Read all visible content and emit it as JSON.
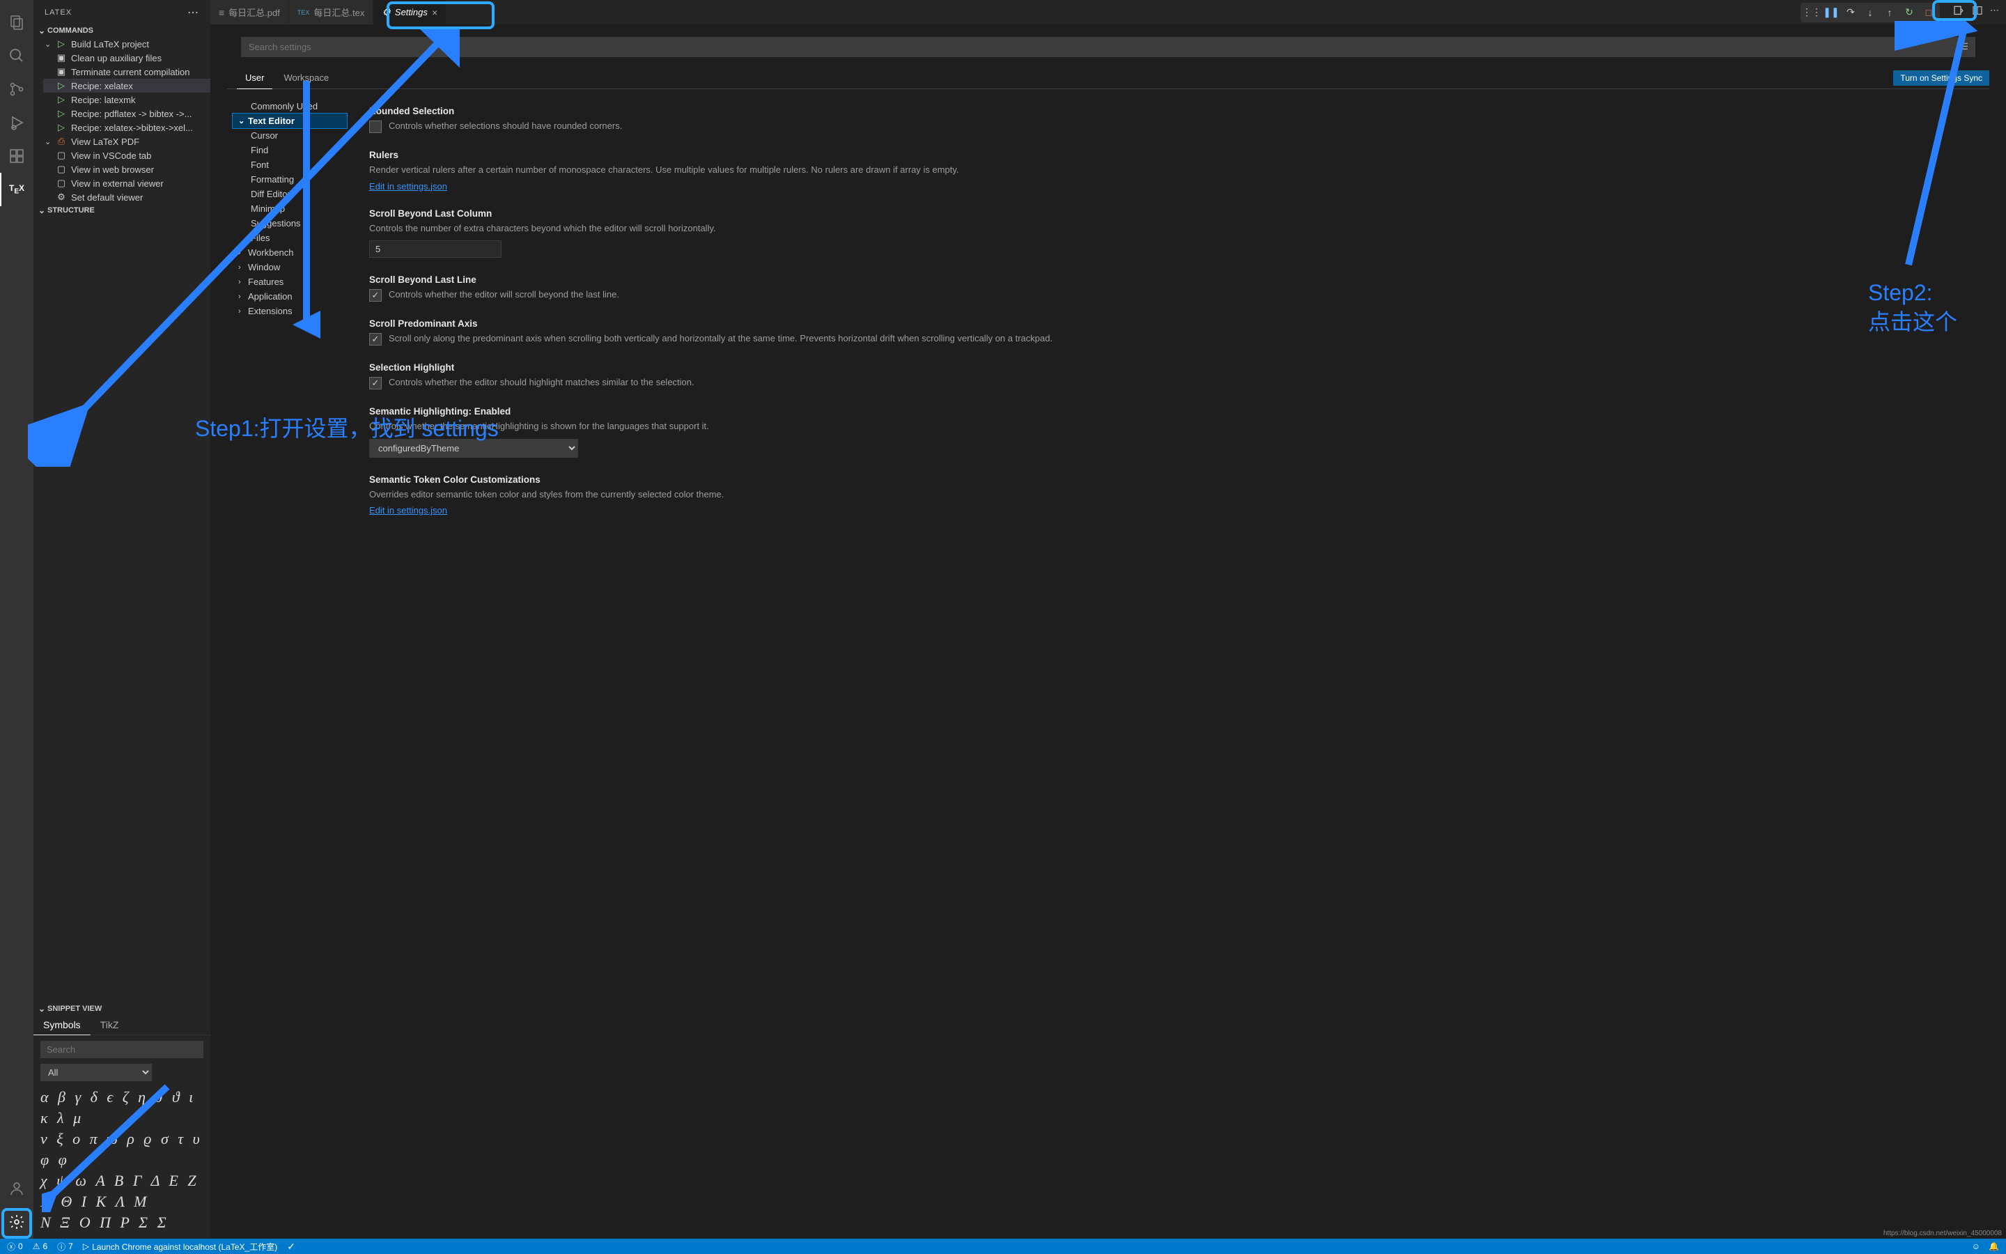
{
  "sidebar": {
    "title": "LATEX",
    "sections": {
      "commands": {
        "label": "COMMANDS",
        "build": "Build LaTeX project",
        "clean": "Clean up auxiliary files",
        "terminate": "Terminate current compilation",
        "recipes": [
          "Recipe: xelatex",
          "Recipe: latexmk",
          "Recipe: pdflatex -> bibtex ->...",
          "Recipe: xelatex->bibtex->xel..."
        ],
        "view_pdf": "View LaTeX PDF",
        "view_items": [
          "View in VSCode tab",
          "View in web browser",
          "View in external viewer",
          "Set default viewer"
        ]
      },
      "structure": "STRUCTURE",
      "snippet": {
        "label": "SNIPPET VIEW",
        "tabs": {
          "symbols": "Symbols",
          "tikz": "TikZ"
        },
        "search_placeholder": "Search",
        "select_value": "All",
        "rows": [
          "α β γ δ ϵ ζ η θ ϑ ι κ λ μ",
          "ν ξ o π ϖ ρ ϱ σ τ υ φ φ",
          "χ ψ ω A B Γ Δ E Z",
          "H Θ I K Λ M",
          "N Ξ O Π P Σ Σ"
        ]
      }
    }
  },
  "tabs": [
    {
      "label": "每日汇总.pdf",
      "icon": "📄"
    },
    {
      "label": "每日汇总.tex",
      "icon": "TEX"
    },
    {
      "label": "Settings",
      "icon": "⚙"
    }
  ],
  "toolbar": {
    "sync_label": "Turn on Settings Sync"
  },
  "settings": {
    "search_placeholder": "Search settings",
    "scope_user": "User",
    "scope_workspace": "Workspace",
    "toc": {
      "commonly_used": "Commonly Used",
      "text_editor": "Text Editor",
      "cursor": "Cursor",
      "find": "Find",
      "font": "Font",
      "formatting": "Formatting",
      "diff_editor": "Diff Editor",
      "minimap": "Minimap",
      "suggestions": "Suggestions",
      "files": "Files",
      "workbench": "Workbench",
      "window": "Window",
      "features": "Features",
      "application": "Application",
      "extensions": "Extensions"
    },
    "items": {
      "rounded_selection": {
        "title": "Rounded Selection",
        "desc": "Controls whether selections should have rounded corners."
      },
      "rulers": {
        "title": "Rulers",
        "desc": "Render vertical rulers after a certain number of monospace characters. Use multiple values for multiple rulers. No rulers are drawn if array is empty.",
        "link": "Edit in settings.json"
      },
      "scroll_beyond_col": {
        "title": "Scroll Beyond Last Column",
        "desc": "Controls the number of extra characters beyond which the editor will scroll horizontally.",
        "value": "5"
      },
      "scroll_beyond_line": {
        "title": "Scroll Beyond Last Line",
        "desc": "Controls whether the editor will scroll beyond the last line."
      },
      "scroll_predominant": {
        "title": "Scroll Predominant Axis",
        "desc": "Scroll only along the predominant axis when scrolling both vertically and horizontally at the same time. Prevents horizontal drift when scrolling vertically on a trackpad."
      },
      "selection_highlight": {
        "title": "Selection Highlight",
        "desc": "Controls whether the editor should highlight matches similar to the selection."
      },
      "semantic_highlight": {
        "title_prefix": "Semantic Highlighting: ",
        "title_value": "Enabled",
        "desc": "Controls whether the semanticHighlighting is shown for the languages that support it.",
        "select_value": "configuredByTheme"
      },
      "semantic_token": {
        "title": "Semantic Token Color Customizations",
        "desc": "Overrides editor semantic token color and styles from the currently selected color theme.",
        "link": "Edit in settings.json"
      }
    }
  },
  "status": {
    "errors": "0",
    "warnings": "6",
    "info": "7",
    "launch": "Launch Chrome against localhost (LaTeX_工作室)"
  },
  "annotations": {
    "step1": "Step1:打开设置，找到 settings",
    "step2": "Step2:\n点击这个"
  },
  "watermark": "https://blog.csdn.net/weixin_45000008"
}
